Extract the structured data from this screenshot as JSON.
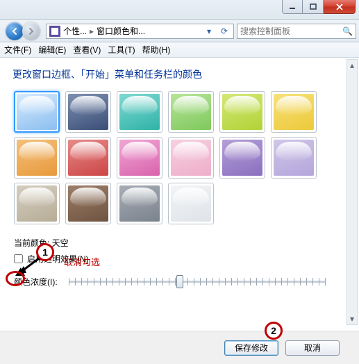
{
  "window_controls": {
    "minimize": "minimize",
    "maximize": "maximize",
    "close": "close"
  },
  "breadcrumb": {
    "seg1": "个性...",
    "seg2": "窗口颜色和..."
  },
  "search": {
    "placeholder": "搜索控制面板"
  },
  "menu": {
    "file": "文件(F)",
    "edit": "编辑(E)",
    "view": "查看(V)",
    "tools": "工具(T)",
    "help": "帮助(H)"
  },
  "heading": "更改窗口边框、「开始」菜单和任务栏的颜色",
  "swatches": [
    {
      "name": "sky",
      "color": "linear-gradient(160deg,#d6e9fb 0%,#a9d0f5 60%,#8cbef0 100%)",
      "selected": true
    },
    {
      "name": "twilight",
      "color": "linear-gradient(160deg,#7e8fb0,#3a4f78)"
    },
    {
      "name": "sea",
      "color": "linear-gradient(160deg,#7fd8d0,#2fb3a8)"
    },
    {
      "name": "leaf",
      "color": "linear-gradient(160deg,#b7e49a,#7fc95c)"
    },
    {
      "name": "lime",
      "color": "linear-gradient(160deg,#d4e878,#b1d236)"
    },
    {
      "name": "sun",
      "color": "linear-gradient(160deg,#f6e27a,#edc93a)"
    },
    {
      "name": "pumpkin",
      "color": "linear-gradient(160deg,#f3c07a,#e89a3d)"
    },
    {
      "name": "ruby",
      "color": "linear-gradient(160deg,#e78a8a,#cc4545)"
    },
    {
      "name": "fuchsia",
      "color": "linear-gradient(160deg,#f0a6d4,#d963ad)"
    },
    {
      "name": "blush",
      "color": "linear-gradient(160deg,#f6d0e0,#efaec9)"
    },
    {
      "name": "violet",
      "color": "linear-gradient(160deg,#b49fd6,#8a6fc0)"
    },
    {
      "name": "lavender",
      "color": "linear-gradient(160deg,#cfc6e8,#b4a6dc)"
    },
    {
      "name": "taupe",
      "color": "linear-gradient(160deg,#d4cdbf,#b7ad97)"
    },
    {
      "name": "chocolate",
      "color": "linear-gradient(160deg,#9c7f6a,#6e5340)"
    },
    {
      "name": "slate",
      "color": "linear-gradient(160deg,#a7adb5,#7a828c)"
    },
    {
      "name": "frost",
      "color": "linear-gradient(160deg,#f2f4f6,#dfe3e8)"
    }
  ],
  "current_color_label": "当前颜色: 天空",
  "transparency_checkbox": {
    "label": "启用透明效果(N)",
    "checked": false
  },
  "intensity_label": "颜色浓度(I):",
  "buttons": {
    "save": "保存修改",
    "cancel": "取消"
  },
  "annotations": {
    "marker1": "1",
    "marker2": "2",
    "uncheck_text": "取消勾选"
  }
}
